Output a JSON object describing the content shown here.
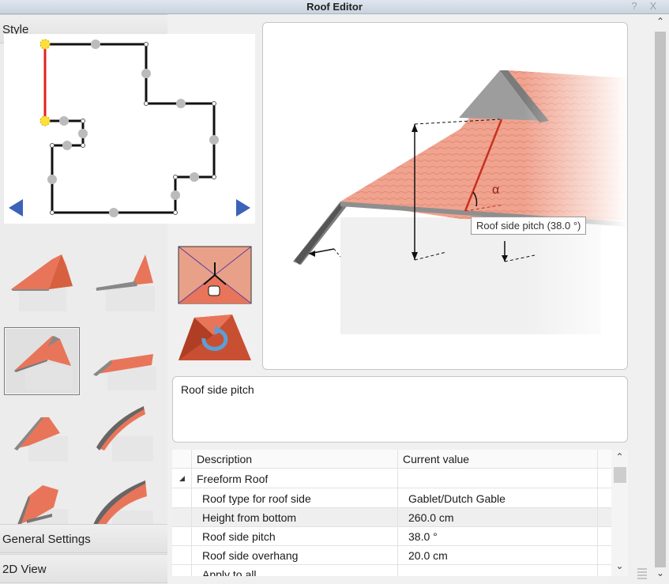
{
  "window": {
    "title": "Roof Editor",
    "help_glyph": "?",
    "close_glyph": "X"
  },
  "sidebar": {
    "style_label": "Style",
    "general_settings_label": "General Settings",
    "view_2d_label": "2D View"
  },
  "preview": {
    "tooltip": "Roof side pitch   (38.0 °)",
    "angle_symbol": "α"
  },
  "description": {
    "text": "Roof side pitch"
  },
  "properties": {
    "headers": {
      "description": "Description",
      "value": "Current value"
    },
    "group": "Freeform Roof",
    "rows": [
      {
        "name": "Roof type for roof side",
        "value": "Gablet/Dutch Gable"
      },
      {
        "name": "Height from bottom",
        "value": "260.0 cm"
      },
      {
        "name": "Roof side pitch",
        "value": "38.0 °"
      },
      {
        "name": "Roof side overhang",
        "value": "20.0 cm"
      },
      {
        "name": "Apply to all",
        "value": ""
      }
    ]
  },
  "icons": {
    "prev": "left-arrow-icon",
    "next": "right-arrow-icon",
    "edit_tool": "roof-edge-edit-icon",
    "rotate_tool": "roof-rotate-icon",
    "expander": "triangle-down-icon",
    "scroll_up": "chevron-up-icon",
    "scroll_down": "chevron-down-icon"
  },
  "colors": {
    "roof": "#e8755a",
    "roof_dark": "#c94f32",
    "highlight_edge": "#e02020",
    "nav_arrow": "#3c63b8"
  }
}
